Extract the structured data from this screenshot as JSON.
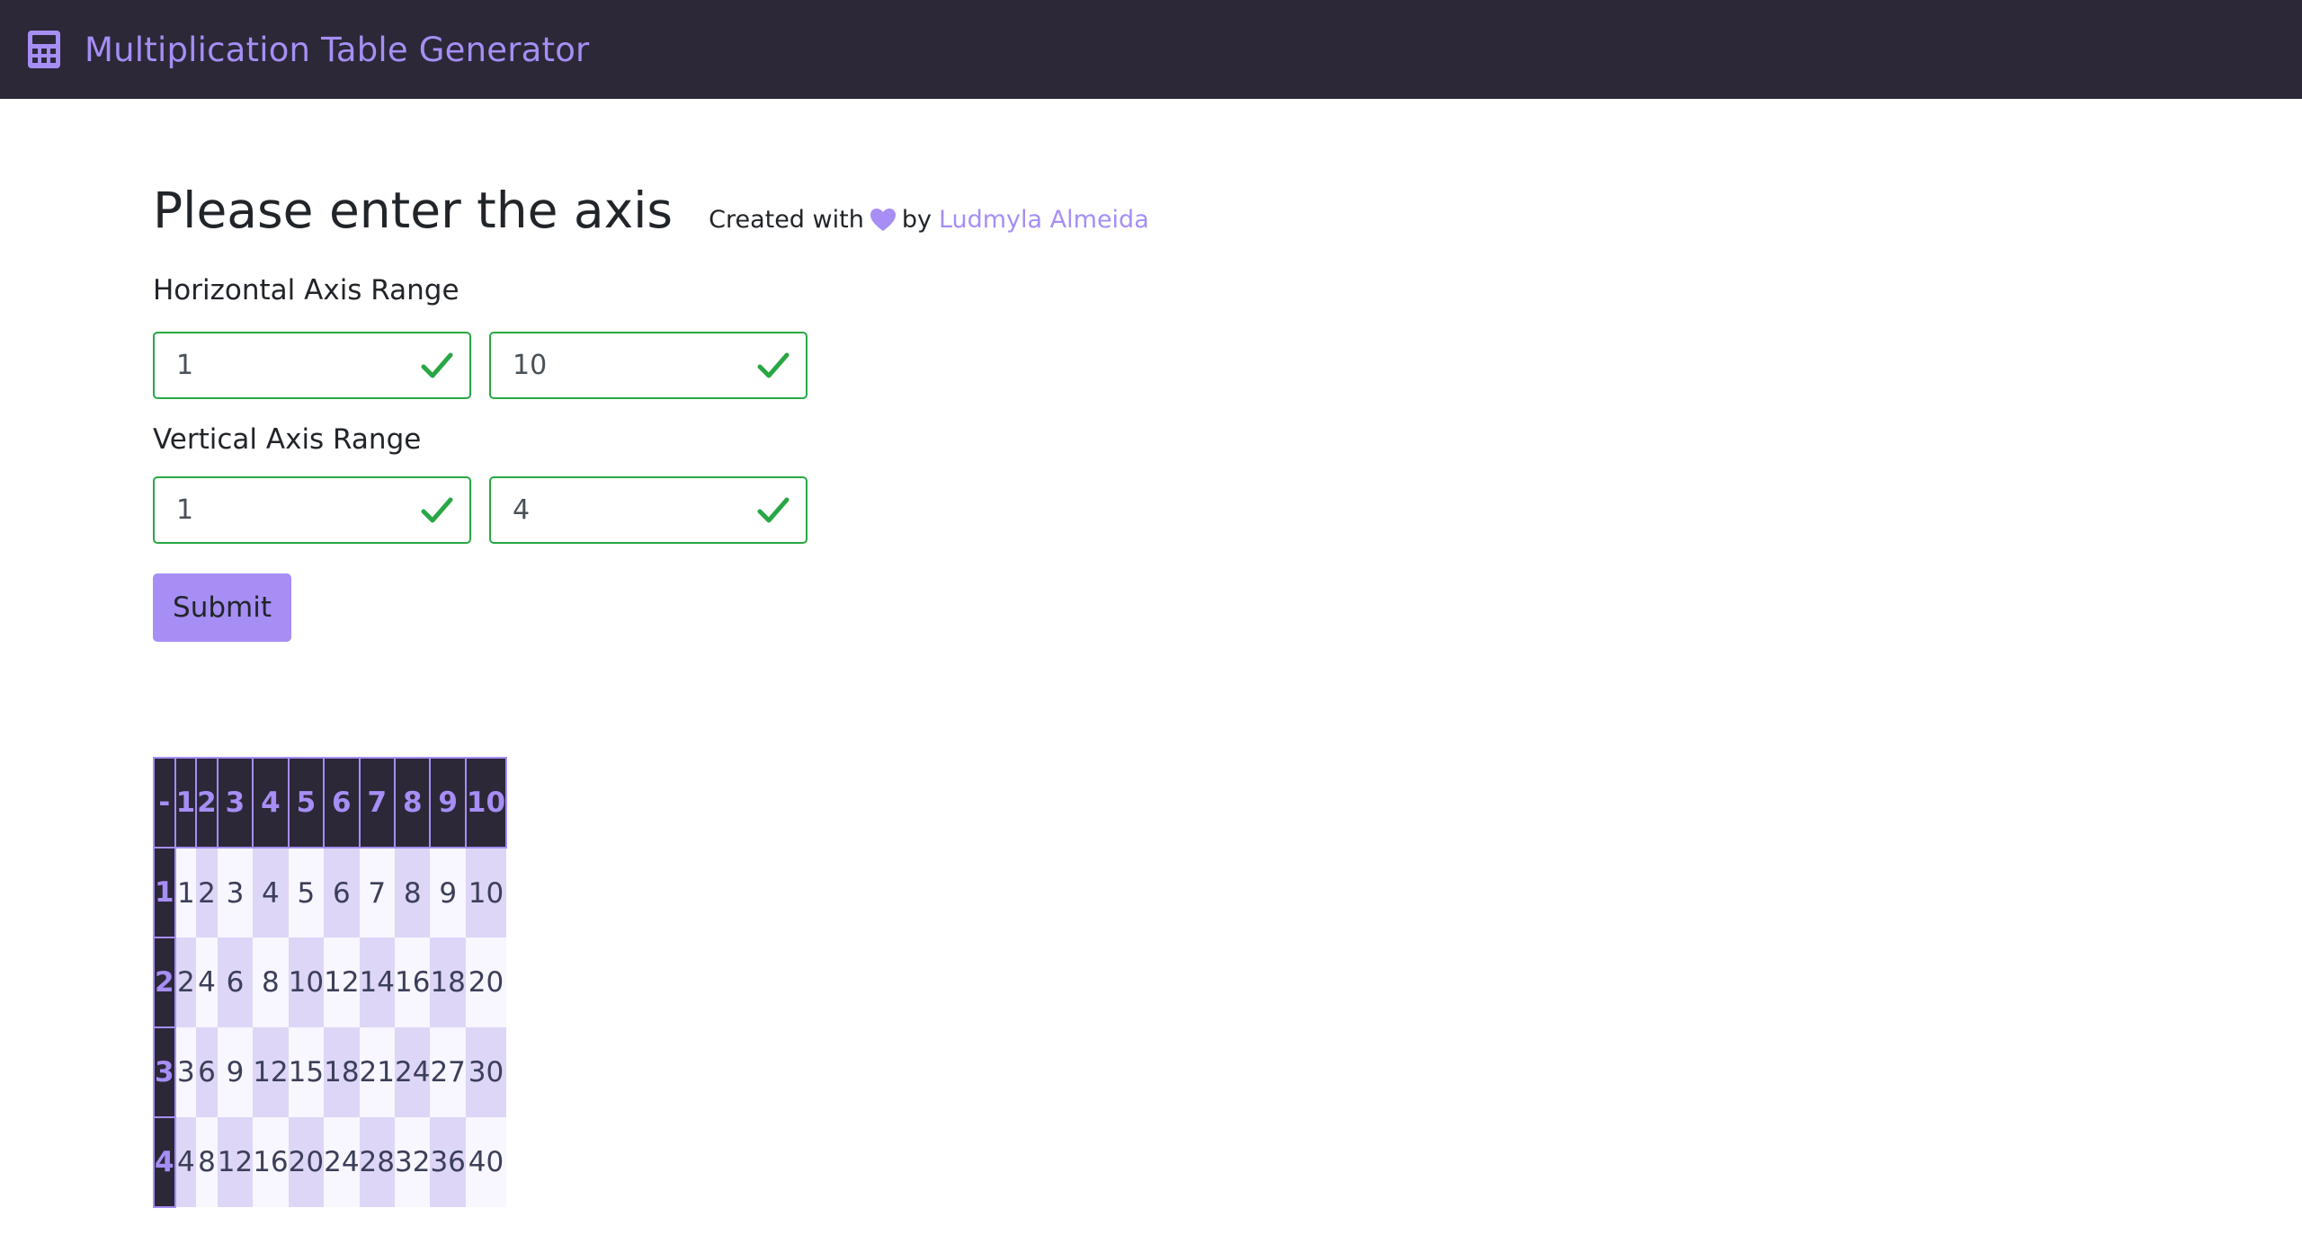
{
  "navbar": {
    "title": "Multiplication Table Generator",
    "icon": "calculator-icon"
  },
  "header": {
    "title": "Please enter the axis",
    "credit_prefix": "Created with",
    "credit_by": "by",
    "author": "Ludmyla Almeida"
  },
  "form": {
    "horizontal_label": "Horizontal Axis Range",
    "vertical_label": "Vertical Axis Range",
    "h_min": "1",
    "h_max": "10",
    "v_min": "1",
    "v_max": "4",
    "submit_label": "Submit"
  },
  "table": {
    "corner": "-",
    "columns": [
      "1",
      "2",
      "3",
      "4",
      "5",
      "6",
      "7",
      "8",
      "9",
      "10"
    ],
    "rows": [
      {
        "header": "1",
        "cells": [
          "1",
          "2",
          "3",
          "4",
          "5",
          "6",
          "7",
          "8",
          "9",
          "10"
        ]
      },
      {
        "header": "2",
        "cells": [
          "2",
          "4",
          "6",
          "8",
          "10",
          "12",
          "14",
          "16",
          "18",
          "20"
        ]
      },
      {
        "header": "3",
        "cells": [
          "3",
          "6",
          "9",
          "12",
          "15",
          "18",
          "21",
          "24",
          "27",
          "30"
        ]
      },
      {
        "header": "4",
        "cells": [
          "4",
          "8",
          "12",
          "16",
          "20",
          "24",
          "28",
          "32",
          "36",
          "40"
        ]
      }
    ]
  },
  "colors": {
    "navbar_bg": "#2c2838",
    "accent": "#a68ef5",
    "valid_border": "#28a745",
    "cell_light": "#f8f6fe",
    "cell_dark": "#ddd6f7"
  }
}
